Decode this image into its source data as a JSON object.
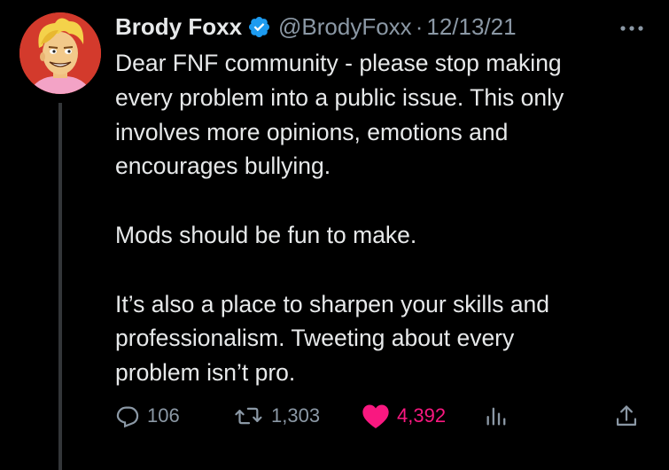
{
  "tweet": {
    "author_name": "Brody Foxx",
    "handle": "@BrodyFoxx",
    "separator": "·",
    "date": "12/13/21",
    "paragraphs": [
      "Dear FNF community - please stop making\nevery problem into a public issue. This only\ninvolves more opinions, emotions and\nencourages bullying.",
      "Mods should be fun to make.",
      "It’s also a place to sharpen your skills and\nprofessionalism. Tweeting about every\nproblem isn’t pro."
    ]
  },
  "actions": {
    "replies": "106",
    "retweets": "1,303",
    "likes": "4,392",
    "liked": true
  },
  "colors": {
    "background": "#000000",
    "text_primary": "#e7e9ea",
    "text_secondary": "#8b98a5",
    "verified_blue": "#1d9bf0",
    "like_pink": "#f91880"
  },
  "icons": {
    "avatar": "cartoon-avatar",
    "verified": "verified-badge-icon",
    "more": "more-dots-icon",
    "reply": "reply-bubble-icon",
    "retweet": "retweet-icon",
    "like": "heart-icon",
    "views": "analytics-bars-icon",
    "share": "share-upload-icon"
  }
}
